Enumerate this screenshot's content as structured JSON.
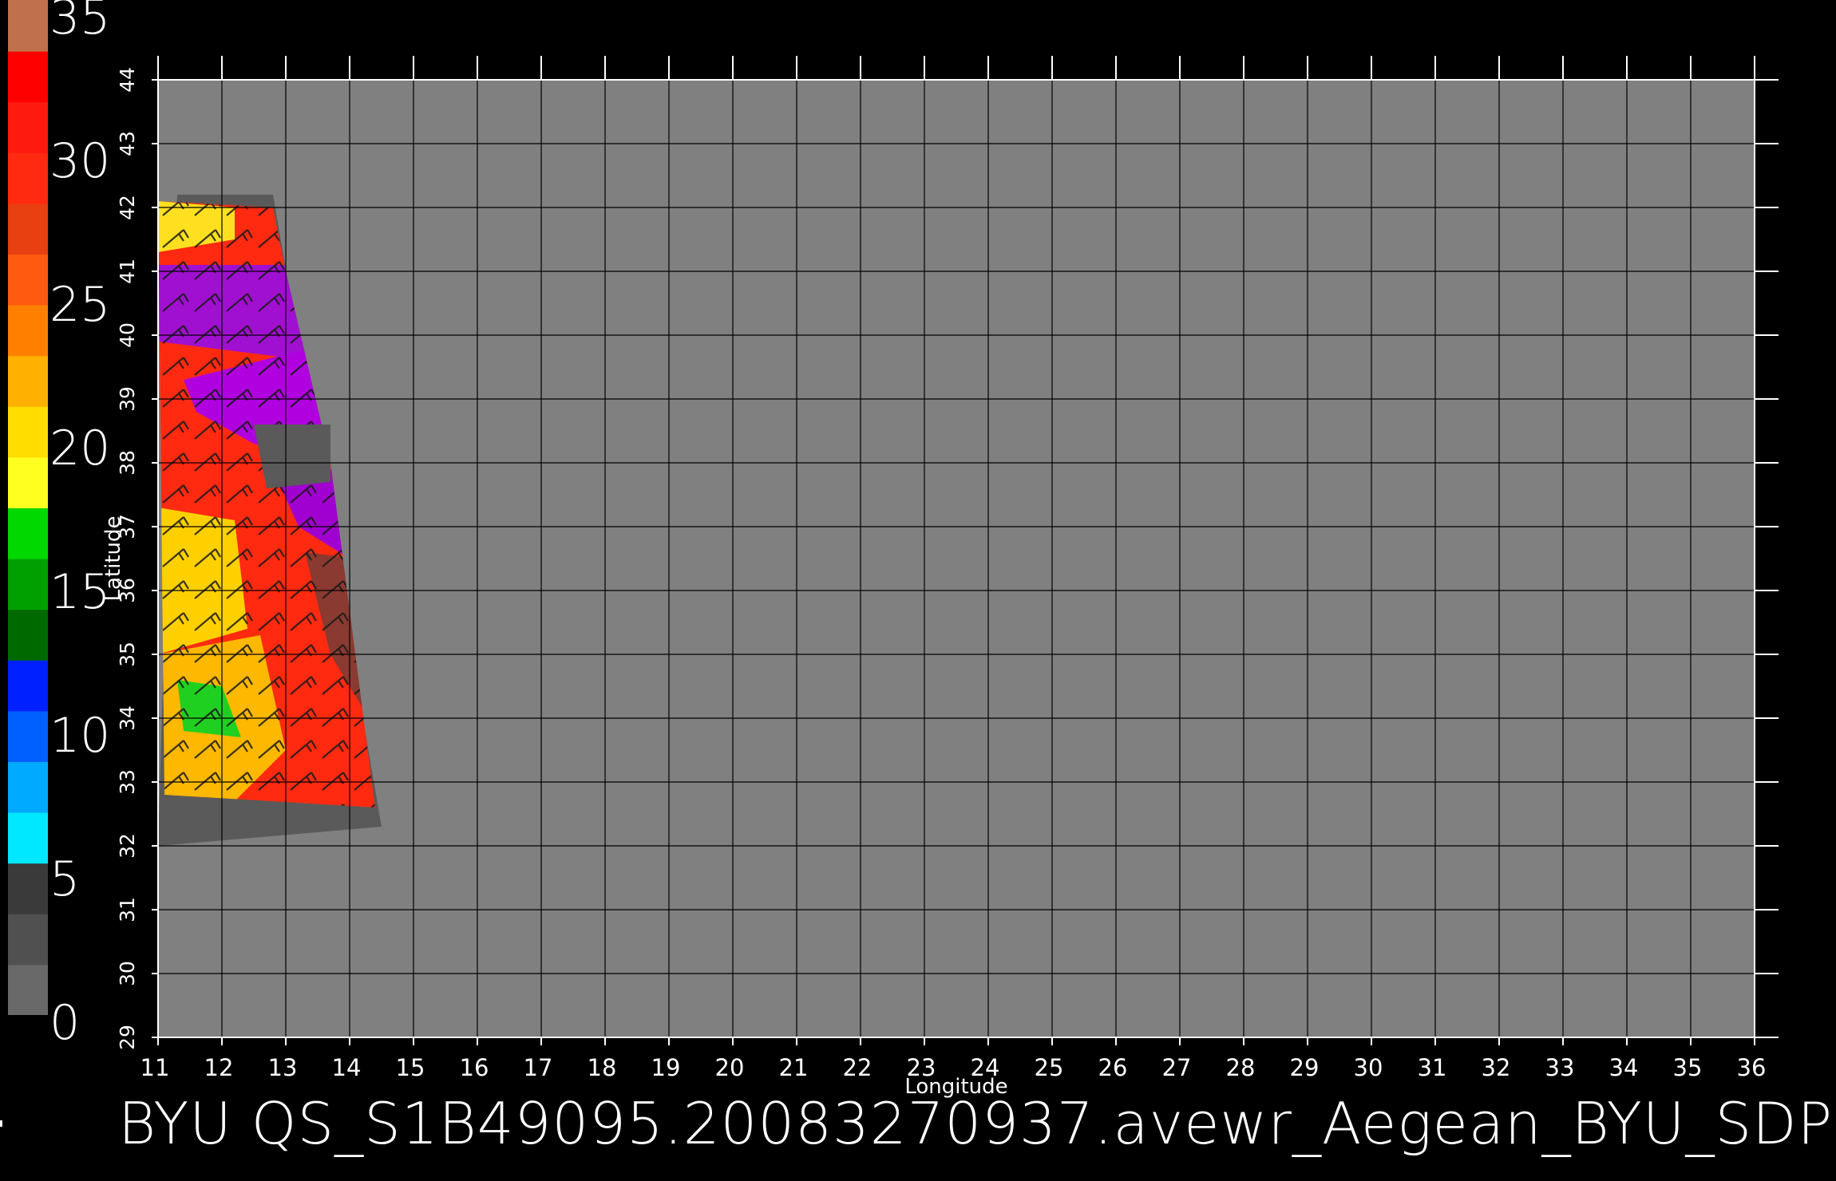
{
  "colorbar": {
    "ticks": [
      "0",
      "5",
      "10",
      "15",
      "20",
      "25",
      "30",
      "35"
    ],
    "colors": [
      "#696969",
      "#505050",
      "#3a3a3a",
      "#00e8ff",
      "#00aaff",
      "#0060ff",
      "#0020ff",
      "#006a00",
      "#00a000",
      "#00d800",
      "#ffff20",
      "#ffdd00",
      "#ffb000",
      "#ff8000",
      "#ff5a10",
      "#e84010",
      "#ff2a10",
      "#ff1a10",
      "#ff0000",
      "#c0704a"
    ]
  },
  "axes": {
    "xlabel": "Longitude",
    "ylabel": "Latitude",
    "x_ticks": [
      "11",
      "12",
      "13",
      "14",
      "15",
      "16",
      "17",
      "18",
      "19",
      "20",
      "21",
      "22",
      "23",
      "24",
      "25",
      "26",
      "27",
      "28",
      "29",
      "30",
      "31",
      "32",
      "33",
      "34",
      "35",
      "36"
    ],
    "y_ticks": [
      "29",
      "30",
      "31",
      "32",
      "33",
      "34",
      "35",
      "36",
      "37",
      "38",
      "39",
      "40",
      "41",
      "42",
      "43",
      "44"
    ]
  },
  "chart_data": {
    "type": "heatmap",
    "xlabel": "Longitude",
    "ylabel": "Latitude",
    "xlim": [
      11,
      36
    ],
    "ylim": [
      29,
      44
    ],
    "grid": true,
    "colorbar_range": [
      0,
      35
    ],
    "swath_footprint_lonlat": [
      [
        11.3,
        42.2
      ],
      [
        12.8,
        42.2
      ],
      [
        14.5,
        32.3
      ],
      [
        11.0,
        32.0
      ]
    ],
    "data_region_lonlat": [
      [
        11.0,
        42.1
      ],
      [
        12.8,
        42.0
      ],
      [
        13.0,
        41.0
      ],
      [
        13.7,
        38.0
      ],
      [
        14.4,
        32.6
      ],
      [
        11.1,
        32.8
      ]
    ],
    "gap_region_lonlat": [
      [
        12.5,
        38.6
      ],
      [
        13.7,
        38.6
      ],
      [
        13.7,
        37.7
      ],
      [
        12.7,
        37.6
      ]
    ],
    "dominant_classes": [
      {
        "range": "25-33",
        "color": "#ff2a10"
      },
      {
        "range": "20-25",
        "color": "#ffdd00"
      },
      {
        "range": "15-20",
        "color": "#00d800"
      },
      {
        "range": ">35",
        "color": "#b000e0"
      }
    ]
  },
  "footer": {
    "text": "BYU  QS_S1B49095.20083270937.avewr_Aegean_BYU_SDP"
  },
  "colors": {
    "background": "#000000",
    "ocean": "#808080",
    "swath_bg": "#5a5a5a",
    "grid": "#000000",
    "frame": "#ffffff"
  }
}
